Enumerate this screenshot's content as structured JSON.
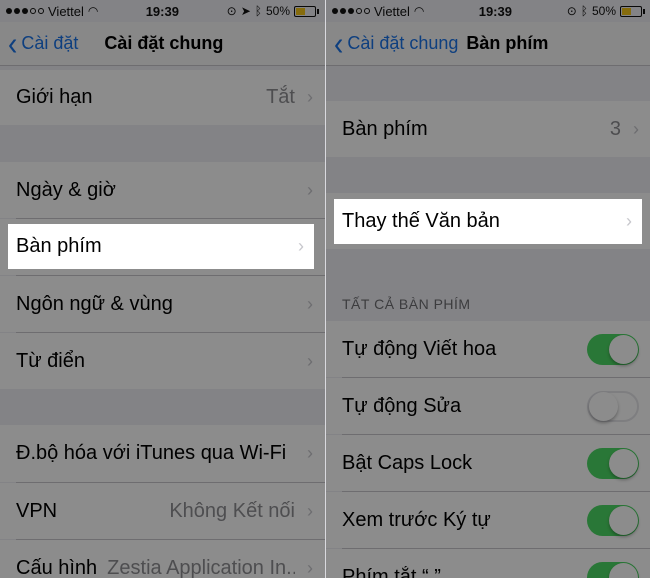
{
  "status": {
    "carrier": "Viettel",
    "time": "19:39",
    "battery": "50%"
  },
  "left": {
    "back_label": "Cài đặt",
    "title": "Cài đặt chung",
    "restrictions": {
      "label": "Giới hạn",
      "value": "Tắt"
    },
    "date_time": "Ngày & giờ",
    "keyboard": "Bàn phím",
    "language_region": "Ngôn ngữ & vùng",
    "dictionary": "Từ điển",
    "itunes_sync": "Đ.bộ hóa với iTunes qua Wi-Fi",
    "vpn": {
      "label": "VPN",
      "value": "Không Kết nối"
    },
    "profile": {
      "label": "Cấu hình",
      "value": "Zestia Application In..."
    }
  },
  "right": {
    "back_label": "Cài đặt chung",
    "title": "Bàn phím",
    "keyboards": {
      "label": "Bàn phím",
      "value": "3"
    },
    "text_replacement": "Thay thế Văn bản",
    "section_header": "TẤT CẢ BÀN PHÍM",
    "toggles": [
      {
        "label": "Tự động Viết hoa",
        "on": true
      },
      {
        "label": "Tự động Sửa",
        "on": false
      },
      {
        "label": "Bật Caps Lock",
        "on": true
      },
      {
        "label": "Xem trước Ký tự",
        "on": true
      },
      {
        "label": "Phím tắt “.”",
        "on": true
      }
    ]
  },
  "colors": {
    "accent": "#1a73e8",
    "toggle_on": "#4cd964",
    "dim_overlay": "rgba(0,0,0,0.45)"
  }
}
